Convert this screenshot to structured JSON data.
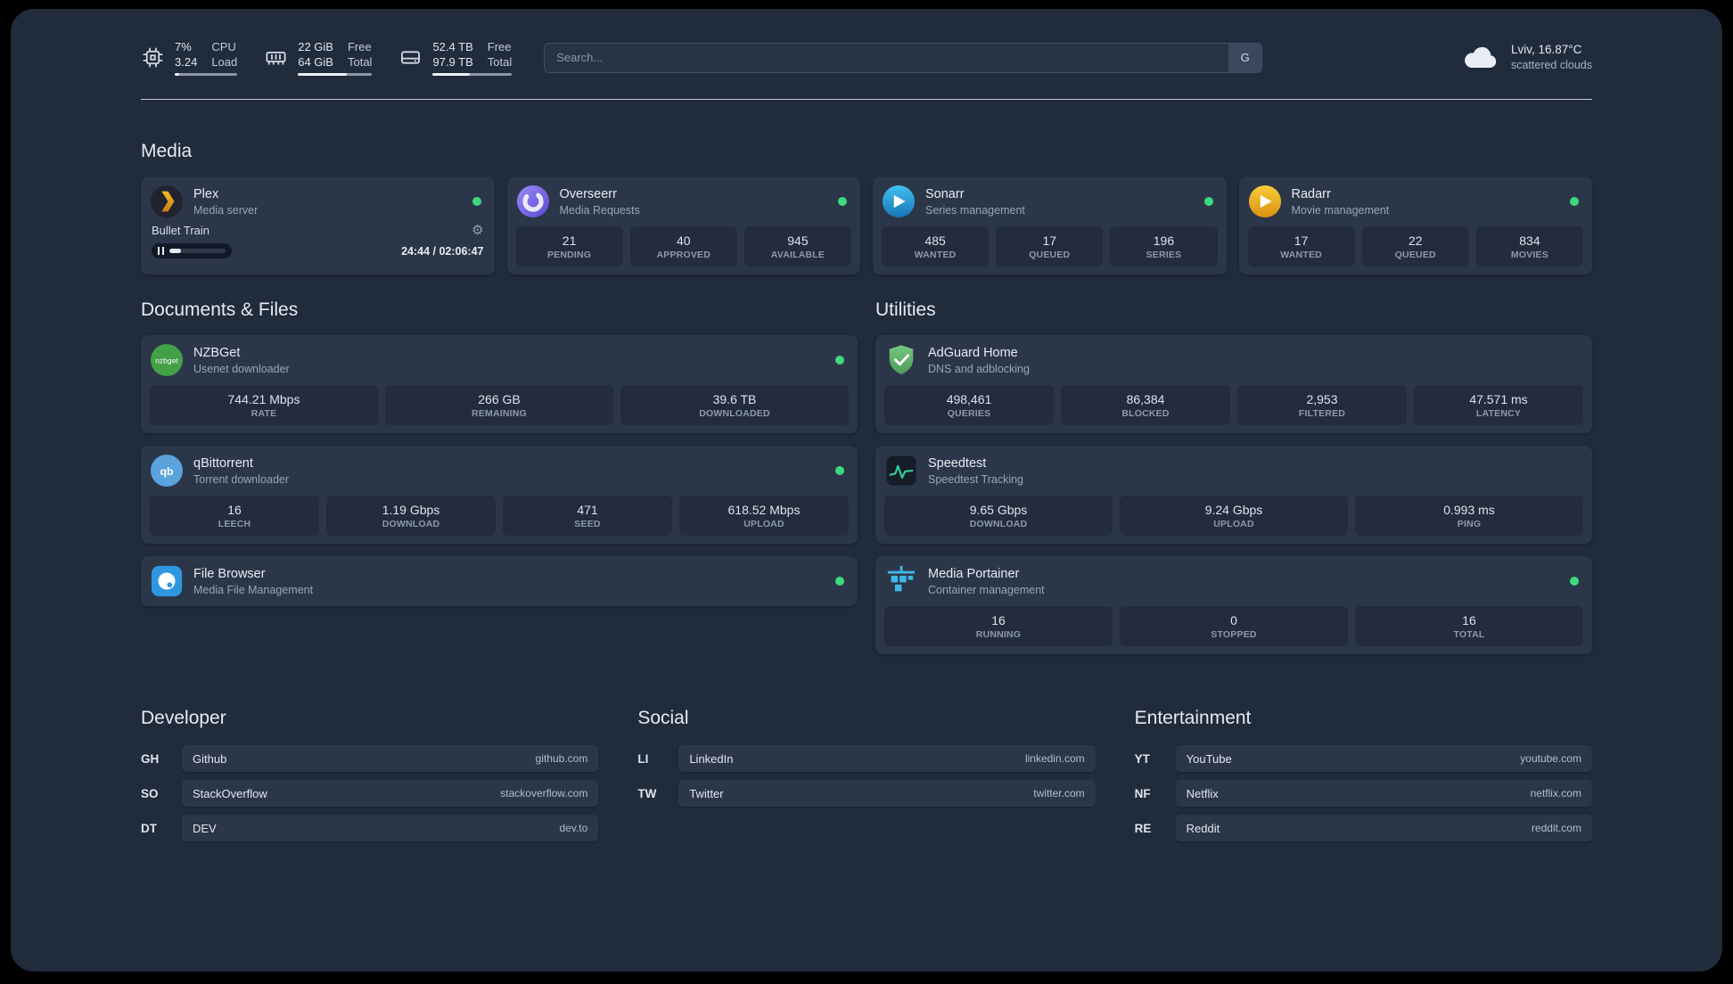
{
  "topbar": {
    "resources": [
      {
        "value_top": "7%",
        "value_bottom": "3.24",
        "label_top": "CPU",
        "label_bottom": "Load",
        "bar_width": "7%"
      },
      {
        "value_top": "22 GiB",
        "value_bottom": "64 GiB",
        "label_top": "Free",
        "label_bottom": "Total",
        "bar_width": "66%"
      },
      {
        "value_top": "52.4 TB",
        "value_bottom": "97.9 TB",
        "label_top": "Free",
        "label_bottom": "Total",
        "bar_width": "47%"
      }
    ],
    "search": {
      "placeholder": "Search...",
      "provider": "G"
    },
    "weather": {
      "location": "Lviv, 16.87°C",
      "condition": "scattered clouds"
    }
  },
  "sections": {
    "media": "Media",
    "documents": "Documents & Files",
    "utilities": "Utilities",
    "developer": "Developer",
    "social": "Social",
    "entertainment": "Entertainment"
  },
  "services": {
    "plex": {
      "name": "Plex",
      "subtitle": "Media server",
      "now_playing": "Bullet Train",
      "time": "24:44 / 02:06:47",
      "progress_width": "20%"
    },
    "overseerr": {
      "name": "Overseerr",
      "subtitle": "Media Requests",
      "stats": [
        {
          "value": "21",
          "label": "PENDING"
        },
        {
          "value": "40",
          "label": "APPROVED"
        },
        {
          "value": "945",
          "label": "AVAILABLE"
        }
      ]
    },
    "sonarr": {
      "name": "Sonarr",
      "subtitle": "Series management",
      "stats": [
        {
          "value": "485",
          "label": "WANTED"
        },
        {
          "value": "17",
          "label": "QUEUED"
        },
        {
          "value": "196",
          "label": "SERIES"
        }
      ]
    },
    "radarr": {
      "name": "Radarr",
      "subtitle": "Movie management",
      "stats": [
        {
          "value": "17",
          "label": "WANTED"
        },
        {
          "value": "22",
          "label": "QUEUED"
        },
        {
          "value": "834",
          "label": "MOVIES"
        }
      ]
    },
    "nzbget": {
      "name": "NZBGet",
      "subtitle": "Usenet downloader",
      "icon_text": "nzbget",
      "stats": [
        {
          "value": "744.21 Mbps",
          "label": "RATE"
        },
        {
          "value": "266 GB",
          "label": "REMAINING"
        },
        {
          "value": "39.6 TB",
          "label": "DOWNLOADED"
        }
      ]
    },
    "qbittorrent": {
      "name": "qBittorrent",
      "subtitle": "Torrent downloader",
      "icon_text": "qb",
      "stats": [
        {
          "value": "16",
          "label": "LEECH"
        },
        {
          "value": "1.19 Gbps",
          "label": "DOWNLOAD"
        },
        {
          "value": "471",
          "label": "SEED"
        },
        {
          "value": "618.52 Mbps",
          "label": "UPLOAD"
        }
      ]
    },
    "filebrowser": {
      "name": "File Browser",
      "subtitle": "Media File Management"
    },
    "adguard": {
      "name": "AdGuard Home",
      "subtitle": "DNS and adblocking",
      "stats": [
        {
          "value": "498,461",
          "label": "QUERIES"
        },
        {
          "value": "86,384",
          "label": "BLOCKED"
        },
        {
          "value": "2,953",
          "label": "FILTERED"
        },
        {
          "value": "47.571 ms",
          "label": "LATENCY"
        }
      ]
    },
    "speedtest": {
      "name": "Speedtest",
      "subtitle": "Speedtest Tracking",
      "stats": [
        {
          "value": "9.65 Gbps",
          "label": "DOWNLOAD"
        },
        {
          "value": "9.24 Gbps",
          "label": "UPLOAD"
        },
        {
          "value": "0.993 ms",
          "label": "PING"
        }
      ]
    },
    "portainer": {
      "name": "Media Portainer",
      "subtitle": "Container management",
      "stats": [
        {
          "value": "16",
          "label": "RUNNING"
        },
        {
          "value": "0",
          "label": "STOPPED"
        },
        {
          "value": "16",
          "label": "TOTAL"
        }
      ]
    }
  },
  "bookmarks": {
    "developer": [
      {
        "abbr": "GH",
        "name": "Github",
        "domain": "github.com"
      },
      {
        "abbr": "SO",
        "name": "StackOverflow",
        "domain": "stackoverflow.com"
      },
      {
        "abbr": "DT",
        "name": "DEV",
        "domain": "dev.to"
      }
    ],
    "social": [
      {
        "abbr": "LI",
        "name": "LinkedIn",
        "domain": "linkedin.com"
      },
      {
        "abbr": "TW",
        "name": "Twitter",
        "domain": "twitter.com"
      }
    ],
    "entertainment": [
      {
        "abbr": "YT",
        "name": "YouTube",
        "domain": "youtube.com"
      },
      {
        "abbr": "NF",
        "name": "Netflix",
        "domain": "netflix.com"
      },
      {
        "abbr": "RE",
        "name": "Reddit",
        "domain": "reddit.com"
      }
    ]
  },
  "icons": {
    "gear": "⚙"
  },
  "colors": {
    "status_online": "#3fd97f",
    "accent_green": "#34d399"
  }
}
